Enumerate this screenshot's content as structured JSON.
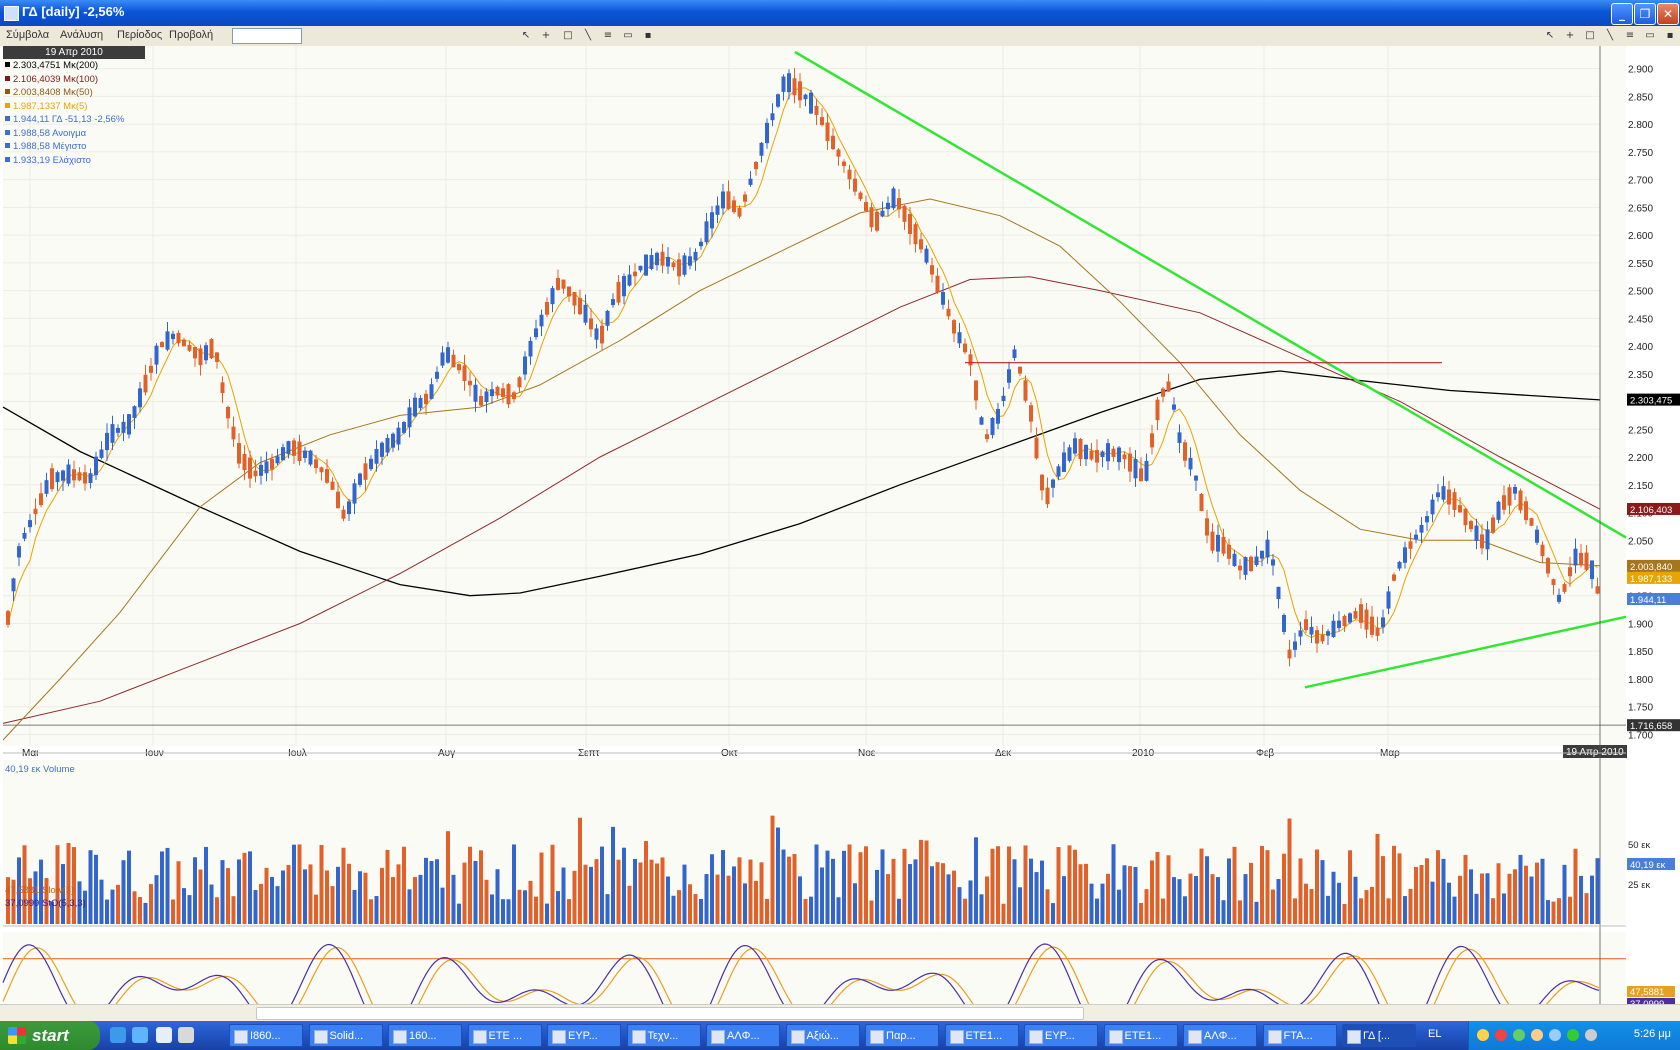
{
  "window": {
    "title": "ΓΔ [daily] -2,56%"
  },
  "menu": [
    {
      "label": "Σύμβολα"
    },
    {
      "label": "Ανάλυση"
    },
    {
      "label": "Περίοδος"
    },
    {
      "label": "Προβολή"
    }
  ],
  "legend": {
    "date": "19 Απρ 2010",
    "items": [
      {
        "text": "2.303,4751 Μκ(200)",
        "color": "#000000"
      },
      {
        "text": "2.106,4039 Μκ(100)",
        "color": "#7a1a1a"
      },
      {
        "text": "2.003,8408 Μκ(50)",
        "color": "#8b5a14"
      },
      {
        "text": "1.987,1337 Μκ(5)",
        "color": "#e8a400"
      },
      {
        "text": "1.944,11 ΓΔ -51,13 -2,56%",
        "color": "#3a6fd0"
      },
      {
        "text": "1.988,58 Ανοιγμα",
        "color": "#3a6fd0"
      },
      {
        "text": "1.988,58 Μέγιστο",
        "color": "#3a6fd0"
      },
      {
        "text": "1.933,19 Ελάχιστο",
        "color": "#3a6fd0"
      }
    ]
  },
  "chart_data": {
    "type": "candlestick",
    "y_axis": {
      "ticks": [
        "2.900",
        "2.850",
        "2.800",
        "2.750",
        "2.700",
        "2.650",
        "2.600",
        "2.550",
        "2.500",
        "2.450",
        "2.400",
        "2.350",
        "2.300",
        "2.250",
        "2.200",
        "2.150",
        "2.100",
        "2.050",
        "2.000",
        "1.950",
        "1.900",
        "1.850",
        "1.800",
        "1.750",
        "1.700"
      ],
      "ylim": [
        1690,
        2930
      ]
    },
    "x_axis": {
      "ticks": [
        "Μαι",
        "Ιουν",
        "Ιουλ",
        "Αυγ",
        "Σεπτ",
        "Οκτ",
        "Νοε",
        "Δεκ",
        "2010",
        "Φεβ",
        "Μαρ"
      ],
      "current": "19 Απρ 2010"
    },
    "price_tags": [
      {
        "text": "2.303,475",
        "value": 2303.5,
        "bg": "#000000"
      },
      {
        "text": "2.106,403",
        "value": 2106.4,
        "bg": "#8b1a1a"
      },
      {
        "text": "2.003,840",
        "value": 2003.8,
        "bg": "#a6761d"
      },
      {
        "text": "1.987,133",
        "value": 1987.1,
        "bg": "#e8a400"
      },
      {
        "text": "1.944,11",
        "value": 1944.1,
        "bg": "#4a7fd6"
      },
      {
        "text": "1.716,658",
        "value": 1716.7,
        "bg": "#333333"
      }
    ],
    "series": [
      {
        "name": "Μκ(200)",
        "color": "#000000"
      },
      {
        "name": "Μκ(100)",
        "color": "#8b2a2a"
      },
      {
        "name": "Μκ(50)",
        "color": "#a6761d"
      },
      {
        "name": "Μκ(5)",
        "color": "#e8a400"
      }
    ],
    "trendlines": [
      {
        "color": "#33e633",
        "from": [
          "Οκτ peak",
          2930
        ],
        "to": [
          "19 Απρ 2010",
          2075
        ]
      },
      {
        "color": "#33e633",
        "from": [
          "Φεβ low",
          1785
        ],
        "to": [
          "19 Απρ 2010",
          1910
        ]
      },
      {
        "color": "#c02020",
        "level": 2370
      }
    ],
    "horizontal_level": 1716.7
  },
  "volume_panel": {
    "label": "40,19 εκ Volume",
    "ticks": [
      "50 εκ",
      "25 εκ"
    ],
    "tag": "40,19 εκ"
  },
  "stoch_panel": {
    "label1": "47,5881 Slow(3)",
    "label2": "37,0999 StO(5,3,3)",
    "tag1": "47,5881",
    "tag2": "37,0999"
  },
  "taskbar": {
    "start": "start",
    "tasks": [
      {
        "label": "I860..."
      },
      {
        "label": "Solid..."
      },
      {
        "label": "160..."
      },
      {
        "label": "ETE ..."
      },
      {
        "label": "ΕΥΡ..."
      },
      {
        "label": "Τεχν..."
      },
      {
        "label": "ΑΛΦ..."
      },
      {
        "label": "Αξιώ..."
      },
      {
        "label": "Παρ..."
      },
      {
        "label": "ΕΤΕ1..."
      },
      {
        "label": "ΕΥΡ..."
      },
      {
        "label": "ΕΤΕ1..."
      },
      {
        "label": "ΑΛΦ..."
      },
      {
        "label": "FTA..."
      },
      {
        "label": "ΓΔ [..."
      }
    ],
    "lang": "EL",
    "clock": "5:26 μμ"
  }
}
